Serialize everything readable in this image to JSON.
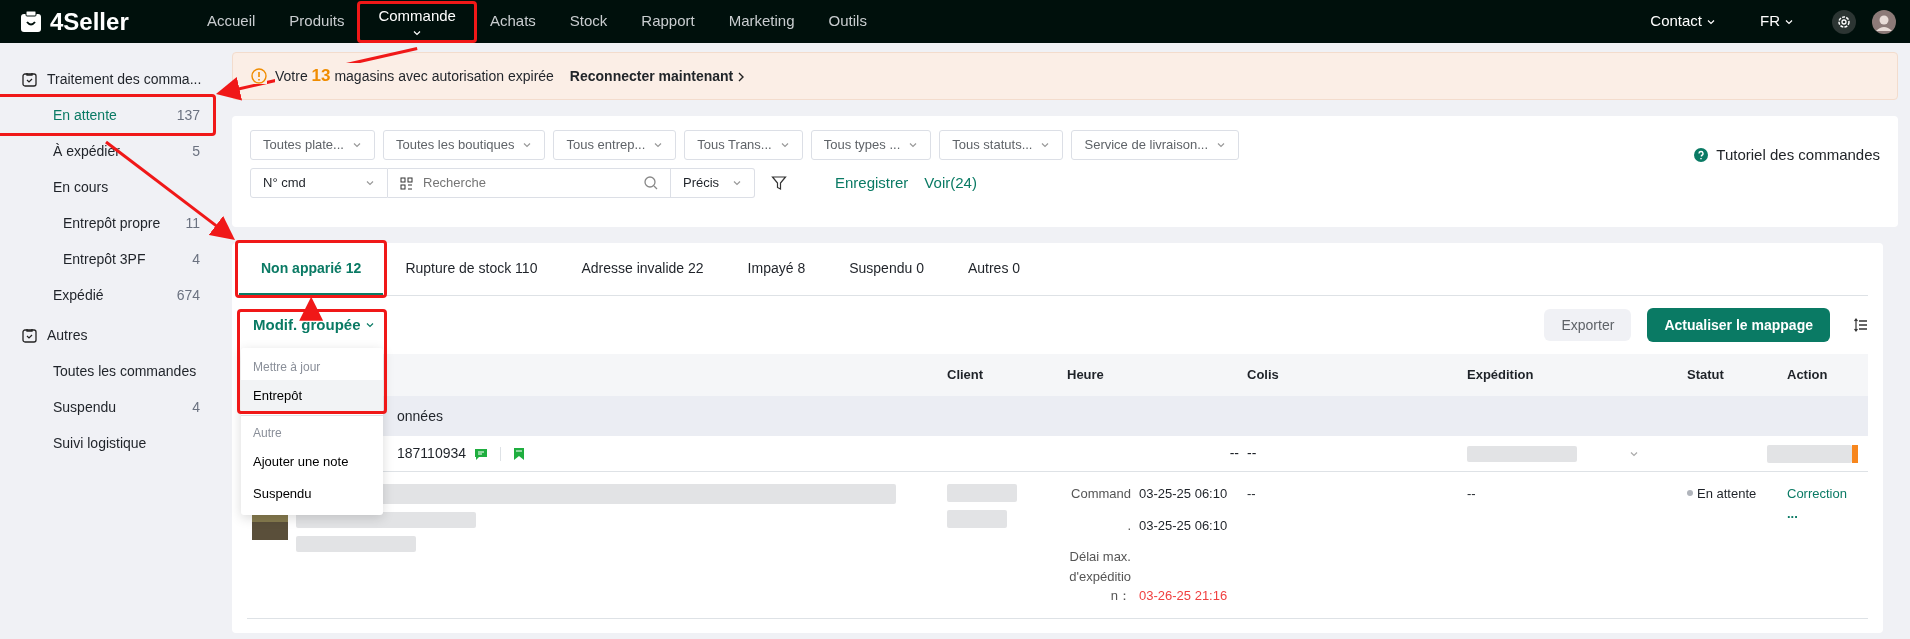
{
  "brand": "4Seller",
  "nav": [
    {
      "label": "Accueil",
      "selected": false,
      "highlighted": false
    },
    {
      "label": "Produits",
      "selected": false,
      "highlighted": false
    },
    {
      "label": "Commande",
      "selected": true,
      "highlighted": true
    },
    {
      "label": "Achats",
      "selected": false,
      "highlighted": false
    },
    {
      "label": "Stock",
      "selected": false,
      "highlighted": false
    },
    {
      "label": "Rapport",
      "selected": false,
      "highlighted": false
    },
    {
      "label": "Marketing",
      "selected": false,
      "highlighted": false
    },
    {
      "label": "Outils",
      "selected": false,
      "highlighted": false
    }
  ],
  "header_right": {
    "contact": "Contact",
    "language": "FR"
  },
  "sidebar": {
    "groups": [
      {
        "title": "Traitement des comma...",
        "items": [
          {
            "label": "En attente",
            "count": "137",
            "selected": true,
            "highlighted": true
          },
          {
            "label": "À expédier",
            "count": "5",
            "selected": false,
            "highlighted": false
          },
          {
            "label": "En cours",
            "selected": false,
            "highlighted": false,
            "children": [
              {
                "label": "Entrepôt propre",
                "count": "11",
                "selected": false,
                "highlighted": false
              },
              {
                "label": "Entrepôt 3PF",
                "count": "4",
                "selected": false,
                "highlighted": false
              }
            ]
          },
          {
            "label": "Expédié",
            "count": "674",
            "selected": false,
            "highlighted": false
          }
        ]
      },
      {
        "title": "Autres",
        "items": [
          {
            "label": "Toutes les commandes",
            "selected": false,
            "highlighted": false
          },
          {
            "label": "Suspendu",
            "count": "4",
            "selected": false,
            "highlighted": false
          },
          {
            "label": "Suivi logistique",
            "selected": false,
            "highlighted": false
          }
        ]
      }
    ]
  },
  "banner": {
    "prefix": "Votre",
    "number": "13",
    "suffix": "magasins avec autorisation expirée",
    "link": "Reconnecter maintenant"
  },
  "filters": [
    "Toutes plate...",
    "Toutes les boutiques",
    "Tous entrep...",
    "Tous Trans...",
    "Tous types ...",
    "Tous statuts...",
    "Service de livraison..."
  ],
  "search": {
    "field": "N° cmd",
    "placeholder": "Recherche",
    "match": "Précis",
    "save": "Enregistrer",
    "views": "Voir(24)"
  },
  "tutorial": "Tutoriel des commandes",
  "tabs": [
    {
      "label": "Non apparié 12",
      "selected": true,
      "highlighted": true
    },
    {
      "label": "Rupture de stock 110",
      "selected": false,
      "highlighted": false
    },
    {
      "label": "Adresse invalide 22",
      "selected": false,
      "highlighted": false
    },
    {
      "label": "Impayé 8",
      "selected": false,
      "highlighted": false
    },
    {
      "label": "Suspendu 0",
      "selected": false,
      "highlighted": false
    },
    {
      "label": "Autres 0",
      "selected": false,
      "highlighted": false
    }
  ],
  "bulk_edit": {
    "label": "Modif. groupée",
    "highlighted": true,
    "menu": [
      {
        "heading": "Mettre à jour",
        "highlighted": true,
        "items": [
          {
            "label": "Entrepôt",
            "hovered": true
          }
        ]
      },
      {
        "heading": "Autre",
        "highlighted": false,
        "items": [
          {
            "label": "Ajouter une note",
            "hovered": false
          },
          {
            "label": "Suspendu",
            "hovered": false
          }
        ]
      }
    ]
  },
  "actions": {
    "export": "Exporter",
    "update": "Actualiser le mappage"
  },
  "table": {
    "columns": [
      "Client",
      "Heure",
      "Colis",
      "Expédition",
      "Statut",
      "Action"
    ],
    "group_row": "onnées",
    "order_row": {
      "order_no": "187110934",
      "time": "--",
      "parcel": "--"
    },
    "detail_row": {
      "time_lines": [
        {
          "label": "Command",
          "value": "03-25-25 06:10",
          "overdue": false
        },
        {
          "label": ".",
          "value": "03-25-25 06:10",
          "overdue": false
        },
        {
          "label": "Délai max. d'expédition：",
          "value": "03-26-25 21:16",
          "overdue": true
        }
      ],
      "parcel": "--",
      "shipment": "--",
      "status": "En attente",
      "action": "Correction",
      "more": "..."
    }
  }
}
